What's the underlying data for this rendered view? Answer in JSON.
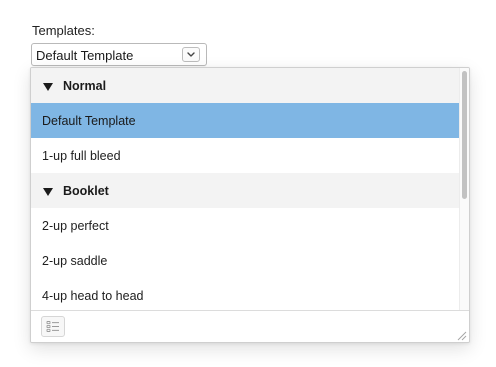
{
  "templates_label": "Templates:",
  "select": {
    "value": "Default Template",
    "chevron_icon": "chevron-down-icon"
  },
  "groups": [
    {
      "name": "Normal",
      "items": [
        {
          "label": "Default Template",
          "selected": true
        },
        {
          "label": "1-up full bleed",
          "selected": false
        }
      ]
    },
    {
      "name": "Booklet",
      "items": [
        {
          "label": "2-up perfect",
          "selected": false
        },
        {
          "label": "2-up saddle",
          "selected": false
        },
        {
          "label": "4-up head to head",
          "selected": false
        }
      ]
    }
  ],
  "footer": {
    "list_button_icon": "list-icon",
    "resize_icon": "resize-grip-icon"
  },
  "colors": {
    "selection": "#7fb6e4",
    "group_header_bg": "#f3f3f3"
  }
}
